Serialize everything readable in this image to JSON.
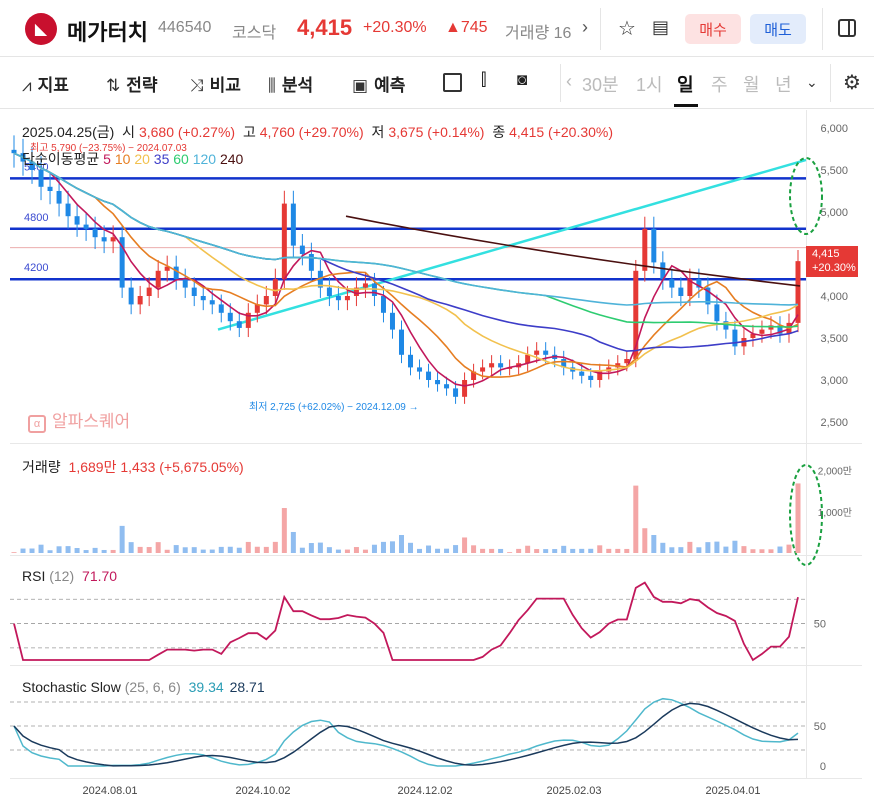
{
  "header": {
    "logo_icon": "chart-logo-icon",
    "stock_name": "메가터치",
    "code": "446540",
    "market": "코스닥",
    "price": "4,415",
    "change_pct": "+20.30%",
    "change_abs": "▲745",
    "volume_label": "거래량 16",
    "buy_label": "매수",
    "sell_label": "매도"
  },
  "toolbar": {
    "items": [
      "지표",
      "전략",
      "비교",
      "분석",
      "예측"
    ],
    "periods": [
      "30분",
      "1시",
      "일",
      "주",
      "월",
      "년"
    ],
    "active_period": "일"
  },
  "colors": {
    "up": "#e53935",
    "down": "#1e88e5",
    "resistance": "#1133cc",
    "trend": "#33e0e0"
  },
  "chart_data": {
    "type": "candlestick",
    "info": {
      "date": "2025.04.25(금)",
      "open_label": "시",
      "open": "3,680 (+0.27%)",
      "high_label": "고",
      "high": "4,760 (+29.70%)",
      "low_label": "저",
      "low": "3,675 (+0.14%)",
      "close_label": "종",
      "close": "4,415 (+20.30%)"
    },
    "max_note": "최고 5,790 (−23.75%) − 2024.07.03",
    "min_note": "최저 2,725 (+62.02%) − 2024.12.09",
    "ma_label": "단순이동평균",
    "ma_periods": [
      "5",
      "10",
      "20",
      "35",
      "60",
      "120",
      "240"
    ],
    "ma_colors": [
      "#c2185b",
      "#e67e22",
      "#f2c14e",
      "#3d3dc8",
      "#2ecc71",
      "#4fb3d9",
      "#4a1010"
    ],
    "watermark": "알파스퀘어",
    "y_ticks": [
      "6,000",
      "5,500",
      "5,000",
      "4,500",
      "4,000",
      "3,500",
      "3,000",
      "2,500"
    ],
    "y_tick_values": [
      6000,
      5500,
      5000,
      4500,
      4000,
      3500,
      3000,
      2500
    ],
    "hlines": [
      {
        "label": "5400",
        "value": 5400
      },
      {
        "label": "4800",
        "value": 4800
      },
      {
        "label": "4200",
        "value": 4200
      }
    ],
    "last_price": "4,415",
    "last_pct": "+20.30%",
    "x_labels": [
      "2024.08.01",
      "2024.10.02",
      "2024.12.02",
      "2025.02.03",
      "2025.04.01"
    ],
    "closes": [
      5700,
      5600,
      5500,
      5300,
      5250,
      5100,
      4950,
      4850,
      4800,
      4700,
      4650,
      4700,
      4100,
      3900,
      4000,
      4100,
      4300,
      4350,
      4200,
      4100,
      4000,
      3950,
      3900,
      3800,
      3700,
      3620,
      3800,
      3900,
      4000,
      4200,
      5100,
      4600,
      4500,
      4300,
      4100,
      4000,
      3950,
      4000,
      4100,
      4150,
      4000,
      3800,
      3600,
      3300,
      3150,
      3100,
      3000,
      2950,
      2900,
      2800,
      3000,
      3100,
      3150,
      3200,
      3150,
      3150,
      3200,
      3300,
      3350,
      3300,
      3250,
      3150,
      3100,
      3050,
      3000,
      3100,
      3150,
      3200,
      3250,
      4300,
      4800,
      4400,
      4200,
      4100,
      4000,
      4200,
      4100,
      3900,
      3700,
      3600,
      3400,
      3500,
      3550,
      3600,
      3650,
      3550,
      3680,
      4415
    ],
    "volume": {
      "label": "거래량",
      "value": "1,689만 1,433 (+5,675.05%)",
      "y_ticks": [
        "2,000만",
        "1,000만"
      ],
      "y_tick_values": [
        20000000,
        10000000
      ],
      "last": 16890000
    },
    "rsi": {
      "label": "RSI",
      "param": "(12)",
      "value": "71.70",
      "y_ticks": [
        "50"
      ],
      "y_tick_values": [
        50
      ],
      "last": 71.7
    },
    "stochastic": {
      "label": "Stochastic Slow",
      "param": "(25, 6, 6)",
      "k_value": "39.34",
      "d_value": "28.71",
      "y_ticks": [
        "50",
        "0"
      ],
      "y_tick_values": [
        50,
        0
      ]
    }
  }
}
